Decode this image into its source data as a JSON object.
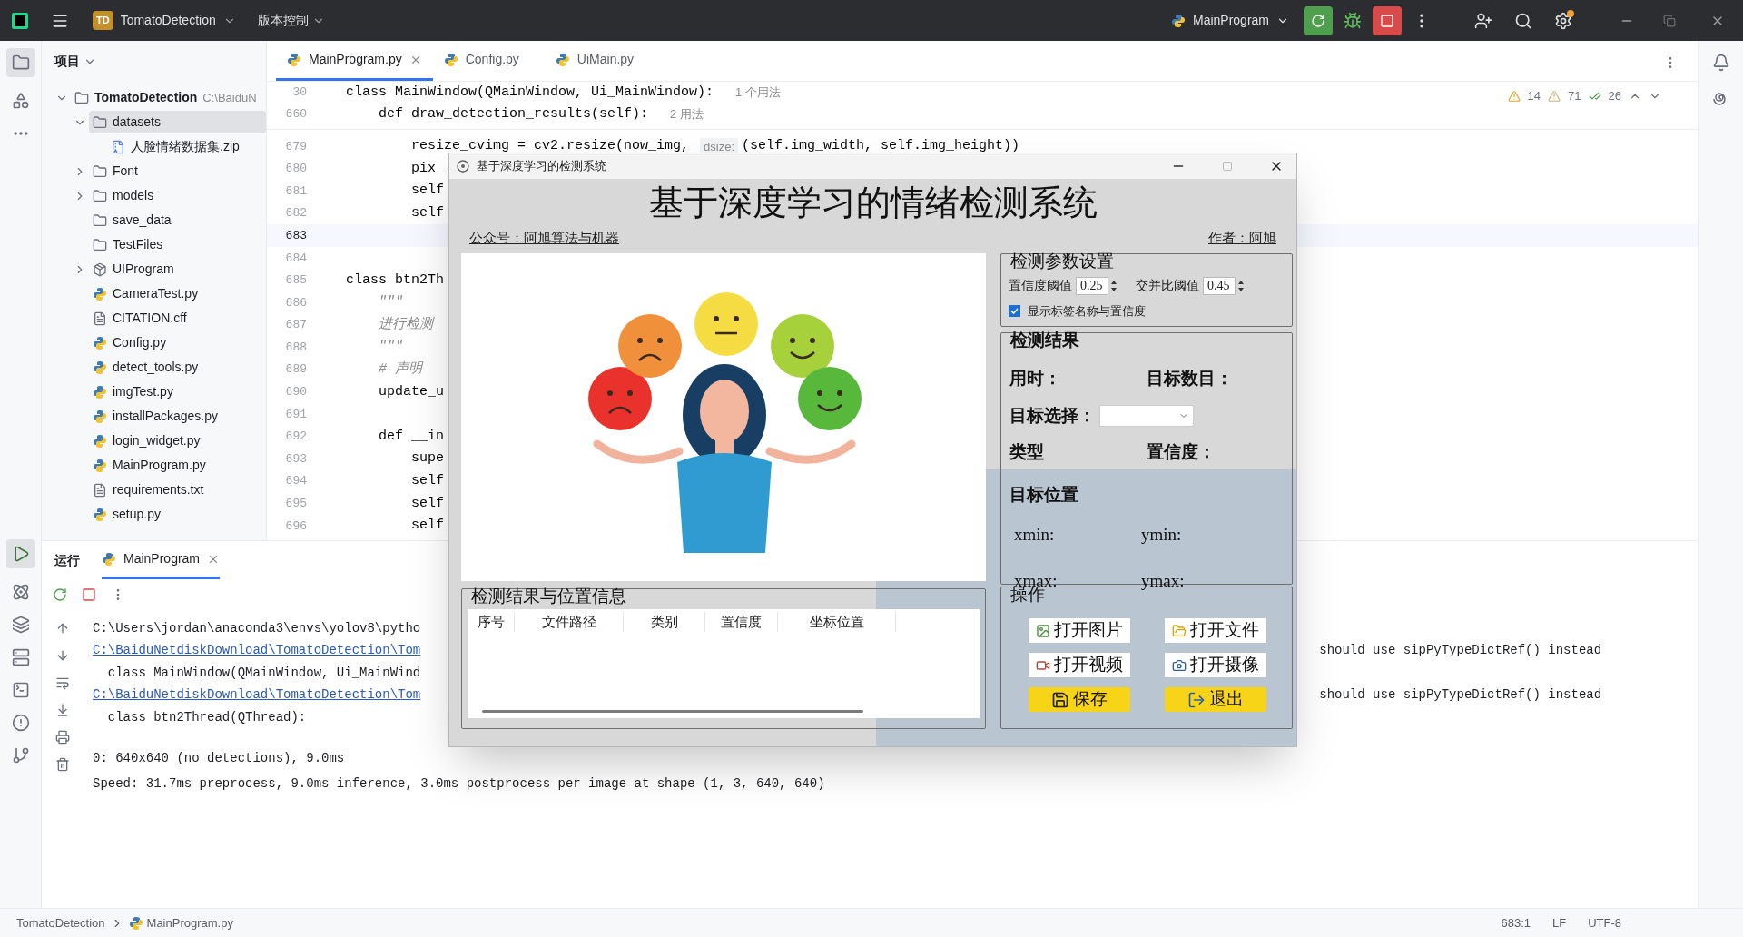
{
  "topbar": {
    "project_badge": "TD",
    "project": "TomatoDetection",
    "vcs": "版本控制",
    "run_config": "MainProgram"
  },
  "project_panel": {
    "title": "项目",
    "tree": [
      {
        "label": "TomatoDetection",
        "path": "C:\\BaiduN",
        "kind": "folder",
        "expanded": true,
        "selected": false,
        "children": [
          {
            "label": "datasets",
            "kind": "folder",
            "expanded": true,
            "selected": true,
            "children": [
              {
                "label": "人脸情绪数据集.zip",
                "kind": "zip",
                "selected": false
              }
            ]
          },
          {
            "label": "Font",
            "kind": "folder",
            "expanded": false,
            "selected": false
          },
          {
            "label": "models",
            "kind": "folder",
            "expanded": false,
            "selected": false
          },
          {
            "label": "save_data",
            "kind": "folder",
            "selected": false
          },
          {
            "label": "TestFiles",
            "kind": "folder",
            "selected": false
          },
          {
            "label": "UIProgram",
            "kind": "package",
            "expanded": false,
            "selected": false
          },
          {
            "label": "CameraTest.py",
            "kind": "python",
            "selected": false
          },
          {
            "label": "CITATION.cff",
            "kind": "text",
            "selected": false
          },
          {
            "label": "Config.py",
            "kind": "python",
            "selected": false
          },
          {
            "label": "detect_tools.py",
            "kind": "python",
            "selected": false
          },
          {
            "label": "imgTest.py",
            "kind": "python",
            "selected": false
          },
          {
            "label": "installPackages.py",
            "kind": "python",
            "selected": false
          },
          {
            "label": "login_widget.py",
            "kind": "python",
            "selected": false
          },
          {
            "label": "MainProgram.py",
            "kind": "python",
            "selected": false
          },
          {
            "label": "requirements.txt",
            "kind": "text",
            "selected": false
          },
          {
            "label": "setup.py",
            "kind": "python",
            "selected": false
          }
        ]
      }
    ]
  },
  "editor": {
    "tabs": [
      {
        "label": "MainProgram.py",
        "selected": true
      },
      {
        "label": "Config.py",
        "selected": false
      },
      {
        "label": "UiMain.py",
        "selected": false
      }
    ],
    "inspections": {
      "errors": "14",
      "warnings": "71",
      "passed": "26"
    },
    "sticky": [
      {
        "number": "30",
        "code": "class MainWindow(QMainWindow, Ui_MainWindow):",
        "hint": "1 个用法"
      },
      {
        "number": "660",
        "code": "    def draw_detection_results(self):",
        "hint": "2 用法"
      }
    ],
    "lines": [
      {
        "number": "679",
        "code": "        resize_cvimg = cv2.resize(now_img,",
        "param": "dsize:",
        "after": "(self.img_width, self.img_height))",
        "kind": "code",
        "current": false
      },
      {
        "number": "680",
        "code": "        pix_",
        "kind": "code",
        "current": false
      },
      {
        "number": "681",
        "code": "        self",
        "kind": "code",
        "current": false
      },
      {
        "number": "682",
        "code": "        self",
        "kind": "code",
        "current": false
      },
      {
        "number": "683",
        "current": true
      },
      {
        "number": "684",
        "current": false
      },
      {
        "number": "685",
        "code": "class btn2Th",
        "kind": "code",
        "current": false
      },
      {
        "number": "686",
        "code": "    \"\"\"",
        "kind": "comment",
        "current": false
      },
      {
        "number": "687",
        "code": "    进行检测",
        "kind": "comment",
        "current": false
      },
      {
        "number": "688",
        "code": "    \"\"\"",
        "kind": "comment",
        "current": false
      },
      {
        "number": "689",
        "code": "    # 声明",
        "kind": "comment",
        "current": false
      },
      {
        "number": "690",
        "code": "    update_u",
        "kind": "code",
        "current": false
      },
      {
        "number": "691",
        "current": false
      },
      {
        "number": "692",
        "code": "    def __in",
        "kind": "code",
        "current": false
      },
      {
        "number": "693",
        "code": "        supe",
        "kind": "code",
        "current": false
      },
      {
        "number": "694",
        "code": "        self",
        "kind": "code",
        "current": false
      },
      {
        "number": "695",
        "code": "        self",
        "kind": "code",
        "current": false
      },
      {
        "number": "696",
        "code": "        self",
        "kind": "code",
        "current": false
      }
    ]
  },
  "run_panel": {
    "title": "运行",
    "tab": "MainProgram",
    "lines": [
      {
        "text": "C:\\Users\\jordan\\anaconda3\\envs\\yolov8\\pytho",
        "kind": "plain"
      },
      {
        "text": "C:\\BaiduNetdiskDownload\\TomatoDetection\\Tom",
        "kind": "link",
        "tail": "should use sipPyTypeDictRef() instead"
      },
      {
        "text": "  class MainWindow(QMainWindow, Ui_MainWind",
        "kind": "plain"
      },
      {
        "text": "C:\\BaiduNetdiskDownload\\TomatoDetection\\Tom",
        "kind": "link",
        "tail": "should use sipPyTypeDictRef() instead"
      },
      {
        "text": "  class btn2Thread(QThread):",
        "kind": "plain"
      },
      {
        "text": "0: 640x640 (no detections), 9.0ms",
        "kind": "plain",
        "gap": true
      },
      {
        "text": "Speed: 31.7ms preprocess, 9.0ms inference, 3.0ms postprocess per image at shape (1, 3, 640, 640)",
        "kind": "plain"
      }
    ]
  },
  "status_bar": {
    "path": [
      "TomatoDetection",
      "MainProgram.py"
    ],
    "position": "683:1",
    "line_ending": "LF",
    "encoding": "UTF-8"
  },
  "dialog": {
    "title": "基于深度学习的检测系统",
    "heading": "基于深度学习的情绪检测系统",
    "account": "公众号：阿旭算法与机器",
    "author": "作者：阿旭",
    "params": {
      "title": "检测参数设置",
      "conf_label": "置信度阈值",
      "conf": "0.25",
      "iou_label": "交并比阈值",
      "iou": "0.45",
      "show_labels": {
        "label": "显示标签名称与置信度",
        "checked": true
      }
    },
    "results": {
      "title": "检测结果",
      "time_label": "用时：",
      "count_label": "目标数目：",
      "select_label": "目标选择：",
      "type_label": "类型",
      "conf_label": "置信度：",
      "position_title": "目标位置",
      "xmin": "xmin:",
      "ymin": "ymin:",
      "xmax": "xmax:",
      "ymax": "ymax:"
    },
    "table": {
      "title": "检测结果与位置信息",
      "columns": [
        "序号",
        "文件路径",
        "类别",
        "置信度",
        "坐标位置"
      ]
    },
    "actions": {
      "title": "操作",
      "buttons": [
        {
          "label": "打开图片",
          "kind": "image",
          "primary": false
        },
        {
          "label": "打开文件",
          "kind": "folder",
          "primary": false
        },
        {
          "label": "打开视频",
          "kind": "video",
          "primary": false
        },
        {
          "label": "打开摄像",
          "kind": "camera",
          "primary": false
        },
        {
          "label": "保存",
          "kind": "save",
          "primary": true
        },
        {
          "label": "退出",
          "kind": "exit",
          "primary": true
        }
      ]
    }
  }
}
